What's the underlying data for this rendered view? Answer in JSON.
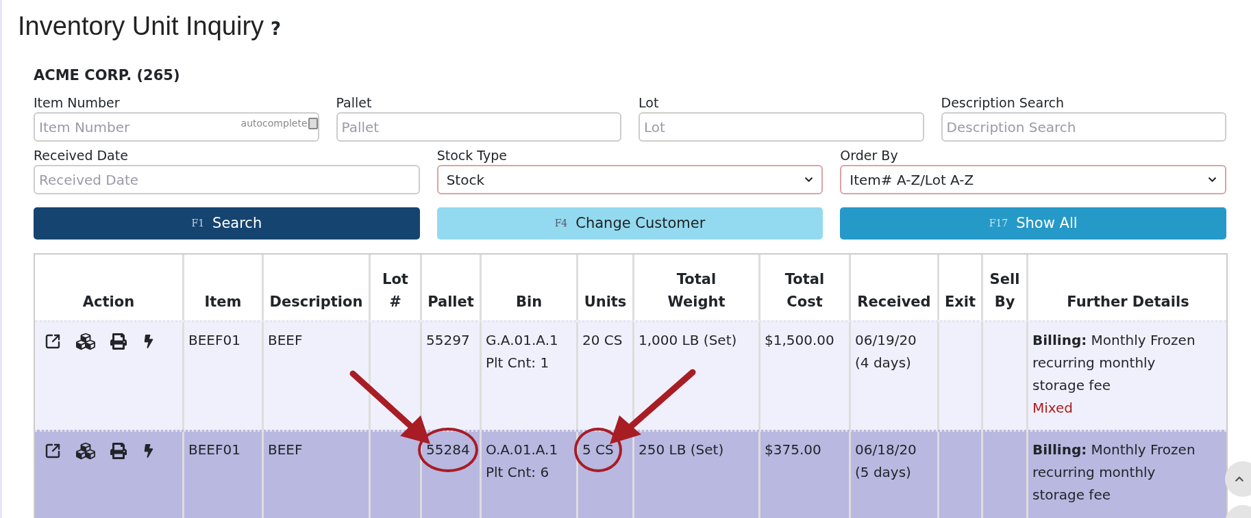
{
  "title": "Inventory Unit Inquiry",
  "help": "?",
  "customer": "ACME CORP. (265)",
  "fields_row1": [
    {
      "label": "Item Number",
      "placeholder": "Item Number",
      "badge": "autocomplete"
    },
    {
      "label": "Pallet",
      "placeholder": "Pallet"
    },
    {
      "label": "Lot",
      "placeholder": "Lot"
    },
    {
      "label": "Description Search",
      "placeholder": "Description Search"
    }
  ],
  "fields_row2": [
    {
      "kind": "input",
      "label": "Received Date",
      "placeholder": "Received Date"
    },
    {
      "kind": "select",
      "label": "Stock Type",
      "value": "Stock"
    },
    {
      "kind": "select",
      "label": "Order By",
      "value": "Item# A-Z/Lot A-Z"
    }
  ],
  "buttons": [
    {
      "kind": "primary",
      "key": "F1",
      "label": "Search"
    },
    {
      "kind": "light",
      "key": "F4",
      "label": "Change Customer"
    },
    {
      "kind": "info",
      "key": "F17",
      "label": "Show All"
    }
  ],
  "table": {
    "columns": [
      "Action",
      "Item",
      "Description",
      "Lot #",
      "Pallet",
      "Bin",
      "Units",
      "Total Weight",
      "Total Cost",
      "Received",
      "Exit",
      "Sell By",
      "Further Details"
    ],
    "rows": [
      {
        "selected": false,
        "item": {
          "lines": [
            "BEEF01"
          ],
          "circled": false
        },
        "description": {
          "lines": [
            "BEEF"
          ],
          "circled": false
        },
        "pallet": {
          "lines": [
            "55297"
          ],
          "circled": false
        },
        "bin": {
          "lines": [
            "G.A.01.A.1",
            "Plt Cnt: 1"
          ],
          "circled": false
        },
        "units": {
          "lines": [
            "20 CS"
          ],
          "circled": false
        },
        "weight": {
          "lines": [
            "1,000 LB (Set)"
          ],
          "circled": false
        },
        "cost": {
          "lines": [
            "$1,500.00"
          ],
          "circled": false
        },
        "received": {
          "lines": [
            "06/19/20",
            "(4 days)"
          ],
          "circled": false
        },
        "details": "**Billing:** Monthly Frozen recurring monthly storage fee",
        "tag": "Mixed"
      },
      {
        "selected": true,
        "item": {
          "lines": [
            "BEEF01"
          ],
          "circled": false
        },
        "description": {
          "lines": [
            "BEEF"
          ],
          "circled": false
        },
        "pallet": {
          "lines": [
            "55284"
          ],
          "circled": true,
          "arrow_from_left": true
        },
        "bin": {
          "lines": [
            "O.A.01.A.1",
            "Plt Cnt: 6"
          ],
          "circled": false
        },
        "units": {
          "lines": [
            "5 CS"
          ],
          "circled": true,
          "arrow_from_left": false
        },
        "weight": {
          "lines": [
            "250 LB (Set)"
          ],
          "circled": false
        },
        "cost": {
          "lines": [
            "$375.00"
          ],
          "circled": false
        },
        "received": {
          "lines": [
            "06/18/20",
            "(5 days)"
          ],
          "circled": false
        },
        "details": "**Billing:** Monthly Frozen recurring monthly storage fee"
      }
    ]
  }
}
